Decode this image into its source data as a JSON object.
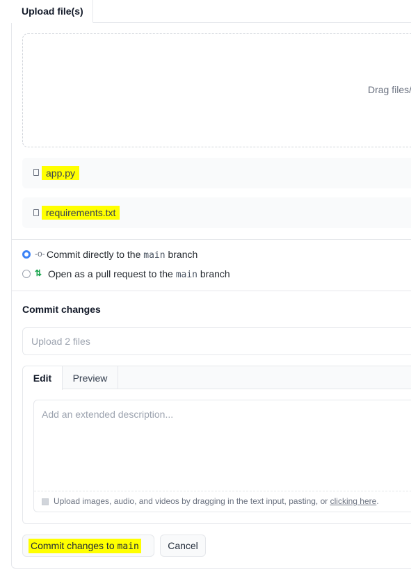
{
  "tabs": {
    "upload": "Upload file(s)"
  },
  "dropzone": {
    "text": "Drag files/"
  },
  "files": [
    {
      "name": "app.py",
      "icon": "file-icon"
    },
    {
      "name": "requirements.txt",
      "icon": "file-icon"
    }
  ],
  "commit_options": {
    "direct": {
      "prefix": "Commit directly to the",
      "branch": "main",
      "suffix": "branch",
      "selected": true,
      "icon": "git-commit-icon"
    },
    "pull_request": {
      "prefix": "Open as a pull request to the",
      "branch": "main",
      "suffix": "branch",
      "selected": false,
      "icon": "git-pull-request-icon"
    }
  },
  "commit": {
    "title": "Commit changes",
    "summary_placeholder": "Upload 2 files",
    "editor_tabs": {
      "edit": "Edit",
      "preview": "Preview"
    },
    "description_placeholder": "Add an extended description...",
    "upload_hint": "Upload images, audio, and videos by dragging in the text input, pasting, or",
    "upload_link": "clicking here",
    "upload_hint_end": "."
  },
  "buttons": {
    "commit_prefix": "Commit changes to",
    "commit_branch": "main",
    "cancel": "Cancel"
  },
  "colors": {
    "highlight": "#ffff00",
    "radio_checked": "#3b82f6",
    "pr_icon": "#16a34a"
  }
}
